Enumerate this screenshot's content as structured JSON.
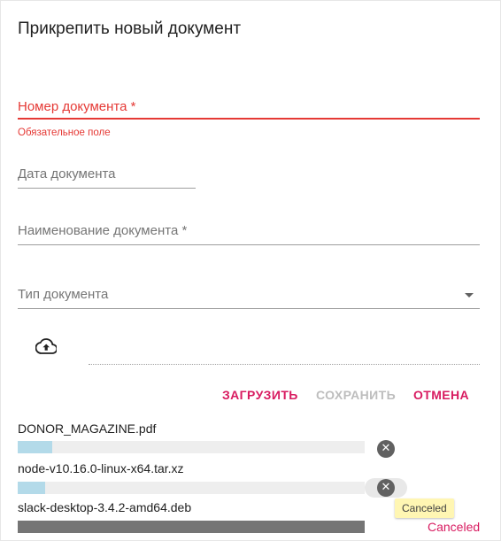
{
  "dialog": {
    "title": "Прикрепить новый документ"
  },
  "form": {
    "doc_number": {
      "label": "Номер документа *",
      "error": "Обязательное поле"
    },
    "doc_date": {
      "label": "Дата документа"
    },
    "doc_name": {
      "label": "Наименование документа *"
    },
    "doc_type": {
      "label": "Тип документа"
    }
  },
  "icons": {
    "upload": "cloud-upload-icon",
    "dropdown": "chevron-down-icon",
    "cancel": "close-circle-icon"
  },
  "actions": {
    "upload_label": "ЗАГРУЗИТЬ",
    "save_label": "СОХРАНИТЬ",
    "cancel_label": "ОТМЕНА"
  },
  "files": [
    {
      "name": "DONOR_MAGAZINE.pdf",
      "progress": 0.1,
      "state": "uploading"
    },
    {
      "name": "node-v10.16.0-linux-x64.tar.xz",
      "progress": 0.08,
      "state": "uploading"
    },
    {
      "name": "slack-desktop-3.4.2-amd64.deb",
      "progress": 1.0,
      "state": "canceled",
      "status_label": "Canceled",
      "tooltip": "Canceled"
    }
  ],
  "colors": {
    "accent": "#d81b60",
    "error": "#e53935",
    "progress": "#b3dae9",
    "tooltip_bg": "#fff6b3"
  }
}
